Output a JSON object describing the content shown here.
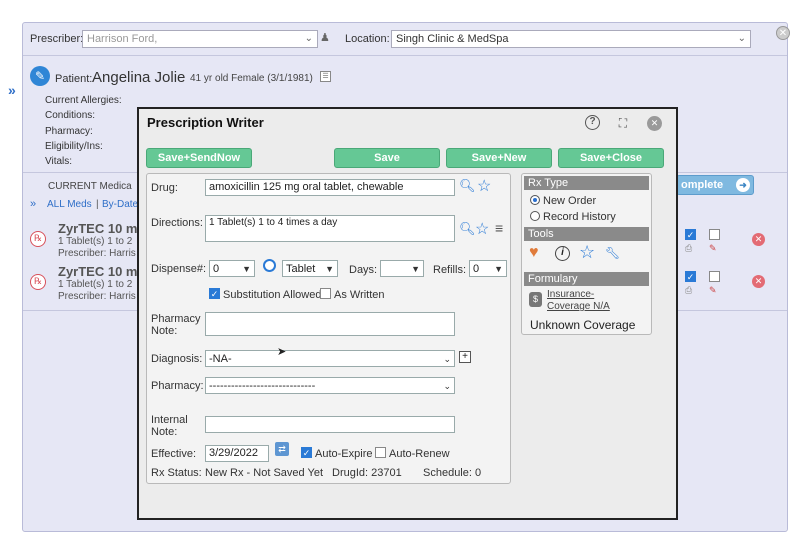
{
  "header": {
    "prescriber_label": "Prescriber:",
    "prescriber_value": "Harrison Ford,",
    "location_label": "Location:",
    "location_value": "Singh Clinic & MedSpa"
  },
  "patient": {
    "label": "Patient:",
    "name": "Angelina Jolie",
    "details": "41 yr old Female (3/1/1981)",
    "fields": [
      "Current Allergies:",
      "Conditions:",
      "Pharmacy:",
      "Eligibility/Ins:",
      "Vitals:"
    ]
  },
  "meds": {
    "current_label": "CURRENT Medica",
    "filter_all": "ALL Meds",
    "filter_sep": "|",
    "filter_date": "By-Date",
    "complete_btn": "omplete",
    "items": [
      {
        "name": "ZyrTEC 10 m",
        "sig": "1 Tablet(s) 1 to 2",
        "prescriber": "Prescriber: Harris"
      },
      {
        "name": "ZyrTEC 10 m",
        "sig": "1 Tablet(s) 1 to 2",
        "prescriber": "Prescriber: Harris"
      }
    ]
  },
  "modal": {
    "title": "Prescription Writer",
    "buttons": {
      "save_send": "Save+SendNow",
      "save": "Save",
      "save_new": "Save+New",
      "save_close": "Save+Close"
    },
    "drug_label": "Drug:",
    "drug_value": "amoxicillin 125 mg oral tablet, chewable",
    "directions_label": "Directions:",
    "directions_value": "1 Tablet(s) 1 to 4 times a day",
    "dispense_label": "Dispense#:",
    "dispense_value": "0",
    "unit_value": "Tablet",
    "days_label": "Days:",
    "days_value": "",
    "refills_label": "Refills:",
    "refills_value": "0",
    "substitution_label": "Substitution Allowed",
    "as_written_label": "As Written",
    "pharmacy_note_label_1": "Pharmacy",
    "pharmacy_note_label_2": "Note:",
    "diagnosis_label": "Diagnosis:",
    "diagnosis_value": "-NA-",
    "plus": "+",
    "pharmacy_label": "Pharmacy:",
    "pharmacy_value": "-----------------------------",
    "internal_label_1": "Internal",
    "internal_label_2": "Note:",
    "effective_label": "Effective:",
    "effective_value": "3/29/2022",
    "auto_expire_label": "Auto-Expire",
    "auto_renew_label": "Auto-Renew",
    "rx_status_label": "Rx Status:",
    "rx_status_value": "New Rx - Not Saved Yet",
    "drugid": "DrugId: 23701",
    "schedule": "Schedule: 0",
    "rx_type_head": "Rx Type",
    "new_order": "New Order",
    "record_history": "Record History",
    "tools_head": "Tools",
    "formulary_head": "Formulary",
    "insurance_link_1": "Insurance-",
    "insurance_link_2": "Coverage N/A",
    "unknown_coverage": "Unknown Coverage"
  },
  "colors": {
    "accent_green": "#65c895",
    "accent_blue": "#2a7ad6",
    "rx_red": "#d8505a"
  }
}
